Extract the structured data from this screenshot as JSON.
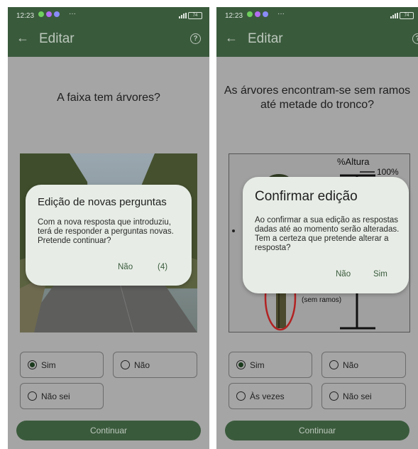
{
  "colors": {
    "app_bar": "#3a5a3c",
    "dialog_bg": "#e7ede6",
    "accent": "#3a5a3c",
    "overlay": "#a5a5a5"
  },
  "status_bar": {
    "time": "12:23",
    "more": "···",
    "battery": "74"
  },
  "left": {
    "app_title": "Editar",
    "question": "A faixa tem árvores?",
    "options": [
      {
        "label": "Sim",
        "selected": true
      },
      {
        "label": "Não",
        "selected": false
      },
      {
        "label": "Não sei",
        "selected": false
      }
    ],
    "continue_label": "Continuar",
    "dialog": {
      "title": "Edição de novas perguntas",
      "body": "Com a nova resposta que introduziu, terá de responder a perguntas novas. Pretende continuar?",
      "no_label": "Não",
      "countdown_label": "(4)"
    }
  },
  "right": {
    "app_title": "Editar",
    "question": "As árvores encontram-se sem ramos até metade do tronco?",
    "diagram": {
      "height_label": "%Altura",
      "percent_label": "100%",
      "no_branches_label": "(sem ramos)"
    },
    "options": [
      {
        "label": "Sim",
        "selected": true
      },
      {
        "label": "Não",
        "selected": false
      },
      {
        "label": "Às vezes",
        "selected": false
      },
      {
        "label": "Não sei",
        "selected": false
      }
    ],
    "continue_label": "Continuar",
    "dialog": {
      "title": "Confirmar edição",
      "body": "Ao confirmar a sua edição as respostas dadas até ao momento serão alteradas. Tem a certeza que pretende alterar a resposta?",
      "no_label": "Não",
      "yes_label": "Sim"
    }
  }
}
